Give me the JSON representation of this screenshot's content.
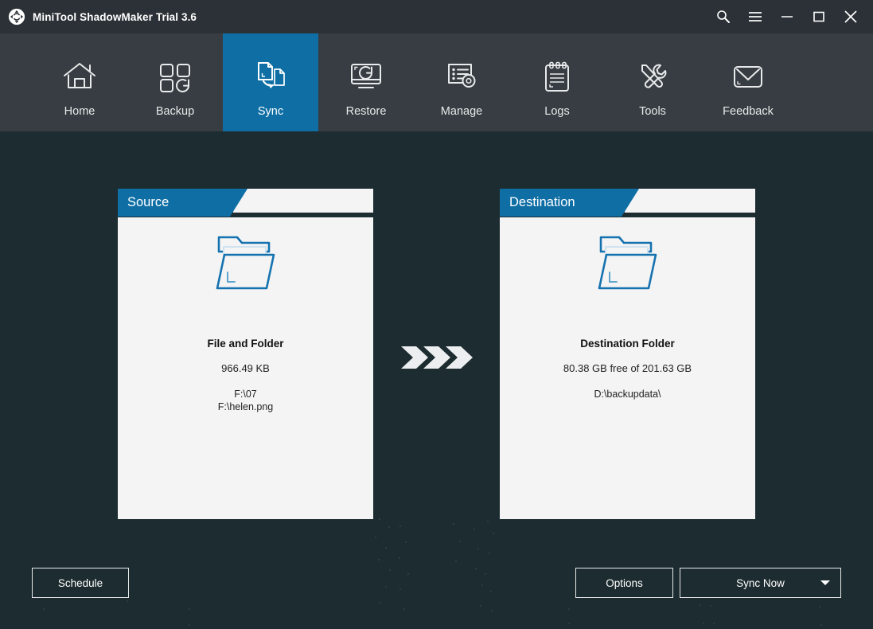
{
  "window": {
    "title": "MiniTool ShadowMaker Trial 3.6",
    "logo_icon": "minitool-sync-logo",
    "controls": [
      {
        "name": "search",
        "icon": "search-icon"
      },
      {
        "name": "menu",
        "icon": "hamburger-menu-icon"
      },
      {
        "name": "minimize",
        "icon": "minimize-icon"
      },
      {
        "name": "maximize",
        "icon": "maximize-icon"
      },
      {
        "name": "close",
        "icon": "close-icon"
      }
    ]
  },
  "nav": {
    "active": "Sync",
    "items": [
      {
        "label": "Home",
        "icon": "home-icon"
      },
      {
        "label": "Backup",
        "icon": "backup-squares-icon"
      },
      {
        "label": "Sync",
        "icon": "sync-documents-icon"
      },
      {
        "label": "Restore",
        "icon": "restore-monitor-icon"
      },
      {
        "label": "Manage",
        "icon": "manage-list-gear-icon"
      },
      {
        "label": "Logs",
        "icon": "logs-clipboard-icon"
      },
      {
        "label": "Tools",
        "icon": "tools-wrench-screwdriver-icon"
      },
      {
        "label": "Feedback",
        "icon": "feedback-envelope-icon"
      }
    ]
  },
  "source": {
    "tab_label": "Source",
    "folder_icon": "folder-icon",
    "title": "File and Folder",
    "size": "966.49 KB",
    "paths": [
      "F:\\07",
      "F:\\helen.png"
    ]
  },
  "destination": {
    "tab_label": "Destination",
    "folder_icon": "folder-icon",
    "title": "Destination Folder",
    "free_space": "80.38 GB free of 201.63 GB",
    "path": "D:\\backupdata\\"
  },
  "transfer": {
    "arrows_icon": "triple-chevron-right-icon"
  },
  "actions": {
    "schedule_label": "Schedule",
    "options_label": "Options",
    "sync_now_label": "Sync Now",
    "sync_now_dropdown_icon": "caret-down-icon"
  },
  "colors": {
    "titlebar": "#2b3136",
    "navbar": "#373d42",
    "accent": "#0f6fa5",
    "content_bg": "#1d2c30",
    "panel_bg": "#f4f4f4",
    "folder_outline": "#1572b0"
  }
}
